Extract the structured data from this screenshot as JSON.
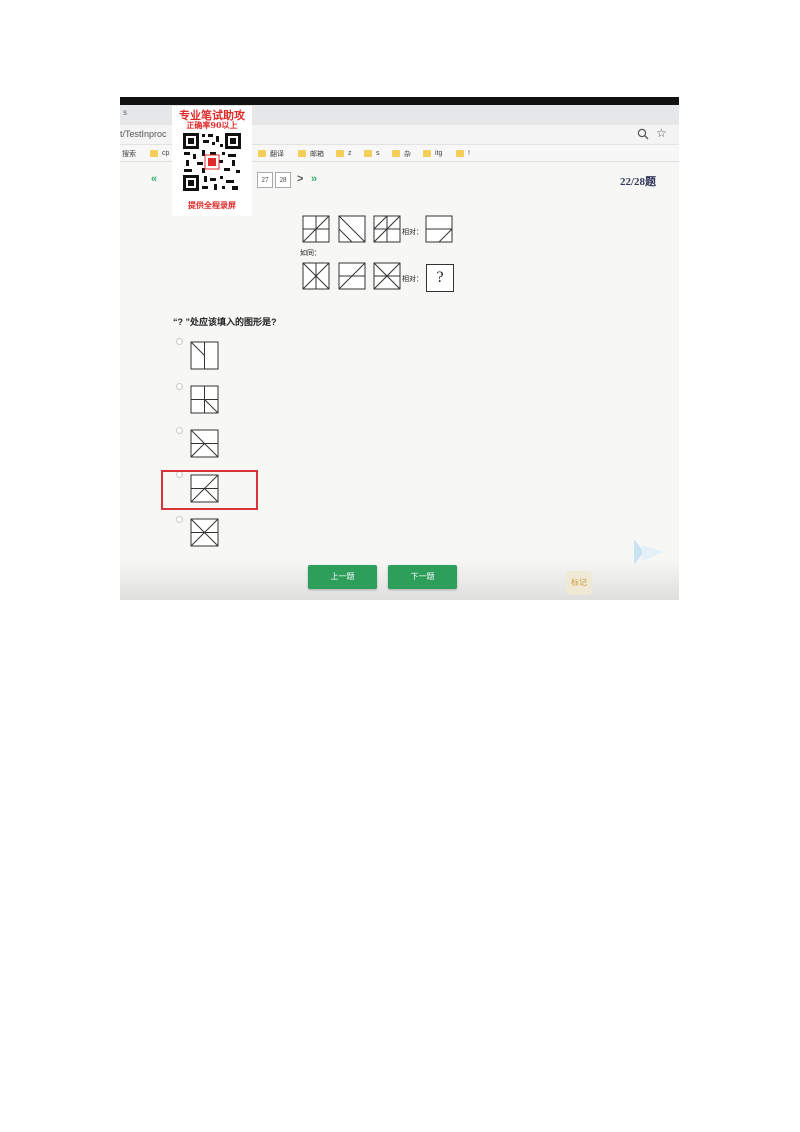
{
  "browser": {
    "tab_partial": "s",
    "url_partial": "t/TestInproc",
    "bookmarks": [
      {
        "label": "搜索",
        "folder": false
      },
      {
        "label": "cp",
        "folder": true
      },
      {
        "label": "翻译",
        "folder": true
      },
      {
        "label": "邮箱",
        "folder": true
      },
      {
        "label": "z",
        "folder": true
      },
      {
        "label": "s",
        "folder": true
      },
      {
        "label": "杂",
        "folder": true
      },
      {
        "label": "itg",
        "folder": true
      },
      {
        "label": "!",
        "folder": true
      }
    ],
    "icons": [
      "zoom-icon",
      "star-icon"
    ]
  },
  "watermark": {
    "line1": "专业笔试助攻",
    "line2": "正确率90以上",
    "line3": "提供全程录屏"
  },
  "pagination": {
    "prev_symbol": "«",
    "next_symbol": "»",
    "chevron_next": ">",
    "pages": [
      "27",
      "28"
    ],
    "counter": "22/28题"
  },
  "question": {
    "label_match": "相对：",
    "label_as": "如同：",
    "unknown_symbol": "?",
    "prompt": "“? ”处应该填入的图形是?",
    "option_count": 5,
    "highlighted_option_index": 3
  },
  "footer": {
    "prev_button": "上一题",
    "next_button": "下一题",
    "mark_button": "标记"
  },
  "colors": {
    "accent_green": "#2e9e5b",
    "highlight_red": "#d9333a",
    "watermark_red": "#e02a2a",
    "counter_color": "#333a5c"
  }
}
